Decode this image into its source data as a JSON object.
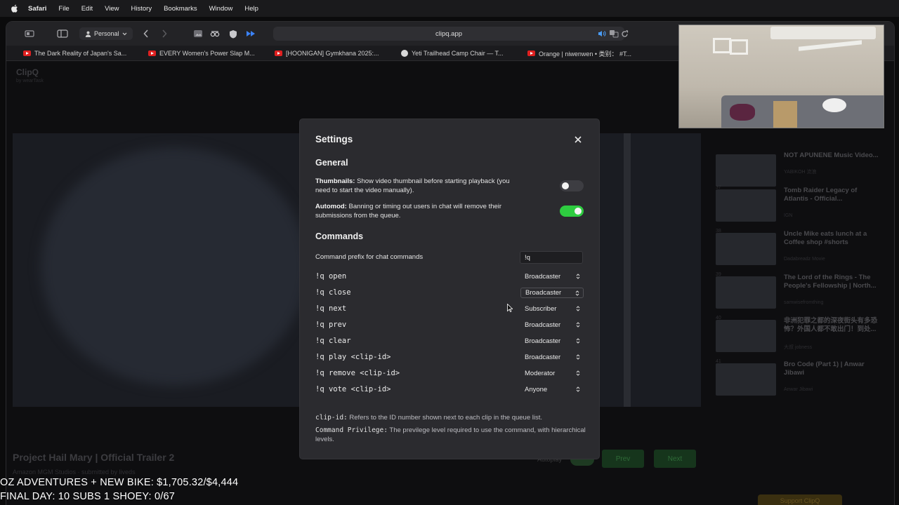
{
  "menubar": {
    "app": "Safari",
    "items": [
      "File",
      "Edit",
      "View",
      "History",
      "Bookmarks",
      "Window",
      "Help"
    ]
  },
  "browser": {
    "profile": "Personal",
    "url": "clipq.app",
    "tabs": [
      {
        "label": "The Dark Reality of Japan's Sa...",
        "icon": "youtube-icon"
      },
      {
        "label": "EVERY Women's Power Slap M...",
        "icon": "youtube-icon"
      },
      {
        "label": "[HOONIGAN] Gymkhana 2025:...",
        "icon": "youtube-icon"
      },
      {
        "label": "Yeti Trailhead Camp Chair — T...",
        "icon": "site-icon"
      },
      {
        "label": "Orange | niwenwen • 类别： #T...",
        "icon": "youtube-icon"
      }
    ]
  },
  "page": {
    "brand": "ClipQ",
    "brand_sub": "by wearTask",
    "video_title": "Project Hail Mary | Official Trailer 2",
    "video_sub": "Amazon MGM Studios · submitted by liveds",
    "autoplay_label": "Autoplay",
    "prev_label": "Prev",
    "next_label": "Next",
    "support_label": "Support ClipQ",
    "queue": [
      {
        "num": "",
        "title": "NOT APUNENE Music Video...",
        "sub": "YABIKOH 流浪"
      },
      {
        "num": "37",
        "title": "Tomb Raider Legacy of Atlantis - Official...",
        "sub": "IGN"
      },
      {
        "num": "38",
        "title": "Uncle Mike eats lunch at a Coffee shop #shorts",
        "sub": "Dadabreadz Movie"
      },
      {
        "num": "39",
        "title": "The Lord of the Rings - The People's Fellowship | North...",
        "sub": "samwisefromthing"
      },
      {
        "num": "40",
        "title": "非洲犯罪之都的深夜街头有多恐怖？外国人都不敢出门！到处...",
        "sub": "大叔 jobness"
      },
      {
        "num": "41",
        "title": "Bro Code (Part 1) | Anwar Jibawi",
        "sub": "Anwar Jibawi"
      }
    ]
  },
  "settings": {
    "title": "Settings",
    "general_heading": "General",
    "thumbnails": {
      "label": "Thumbnails:",
      "desc": "Show video thumbnail before starting playback (you need to start the video manually).",
      "enabled": false
    },
    "automod": {
      "label": "Automod:",
      "desc": "Banning or timing out users in chat will remove their submissions from the queue.",
      "enabled": true
    },
    "commands_heading": "Commands",
    "prefix_label": "Command prefix for chat commands",
    "prefix_value": "!q",
    "commands": [
      {
        "name": "!q open",
        "level": "Broadcaster"
      },
      {
        "name": "!q close",
        "level": "Broadcaster"
      },
      {
        "name": "!q next",
        "level": "Subscriber"
      },
      {
        "name": "!q prev",
        "level": "Broadcaster"
      },
      {
        "name": "!q clear",
        "level": "Broadcaster"
      },
      {
        "name": "!q play <clip-id>",
        "level": "Broadcaster"
      },
      {
        "name": "!q remove <clip-id>",
        "level": "Moderator"
      },
      {
        "name": "!q vote <clip-id>",
        "level": "Anyone"
      }
    ],
    "note_clipid_term": "clip-id:",
    "note_clipid_text": "Refers to the ID number shown next to each clip in the queue list.",
    "note_priv_term": "Command Privilege:",
    "note_priv_text": "The previlege level required to use the command, with hierarchical levels."
  },
  "overlay": {
    "line1": "OZ ADVENTURES + NEW BIKE: $1,705.32/$4,444",
    "line2": "FINAL DAY: 10 SUBS 1 SHOEY: 0/67"
  },
  "colors": {
    "toggle_on": "#2ecc40",
    "modal_bg": "#2b2b2f",
    "youtube_red": "#e02020"
  }
}
